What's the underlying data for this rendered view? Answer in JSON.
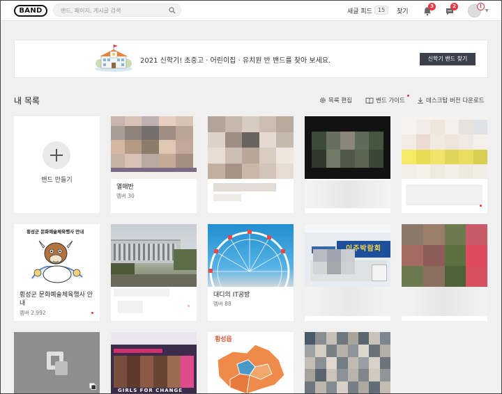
{
  "header": {
    "logo": "BAND",
    "search_placeholder": "밴드, 페이지, 게시글 검색",
    "feed_label": "새글 피드",
    "feed_count": "15",
    "find_label": "찾기",
    "notification_count": "3",
    "chat_count": "2",
    "avatar_alert": "!"
  },
  "banner": {
    "text": "2021 신학기! 초중고 · 어린이집 · 유치원 반 밴드를 찾아 보세요.",
    "button": "신학기 밴드 찾기"
  },
  "list": {
    "title": "내 목록",
    "edit": "목록 편집",
    "guide": "밴드 가이드",
    "download": "데스크탑 버전 다운로드"
  },
  "create": {
    "label": "밴드 만들기"
  },
  "bands": [
    {
      "name": "열매반",
      "members": "멤버 30"
    },
    {
      "name": "횡성군 문화예술체육행사 안내",
      "members": "멤버 2,992",
      "poster_title": "횡성군 문화예술체육행사 안내"
    },
    {
      "name": "대디의 IT공방",
      "members": "멤버 88"
    }
  ],
  "thumb_text": {
    "expo": "이주박람회",
    "map": "횡성읍",
    "girls": "GIRLS FOR CHANGE"
  },
  "colors": {
    "accent_red": "#e8383d",
    "banner_button": "#3a3f4a",
    "page_bg": "#f0f0f0"
  }
}
